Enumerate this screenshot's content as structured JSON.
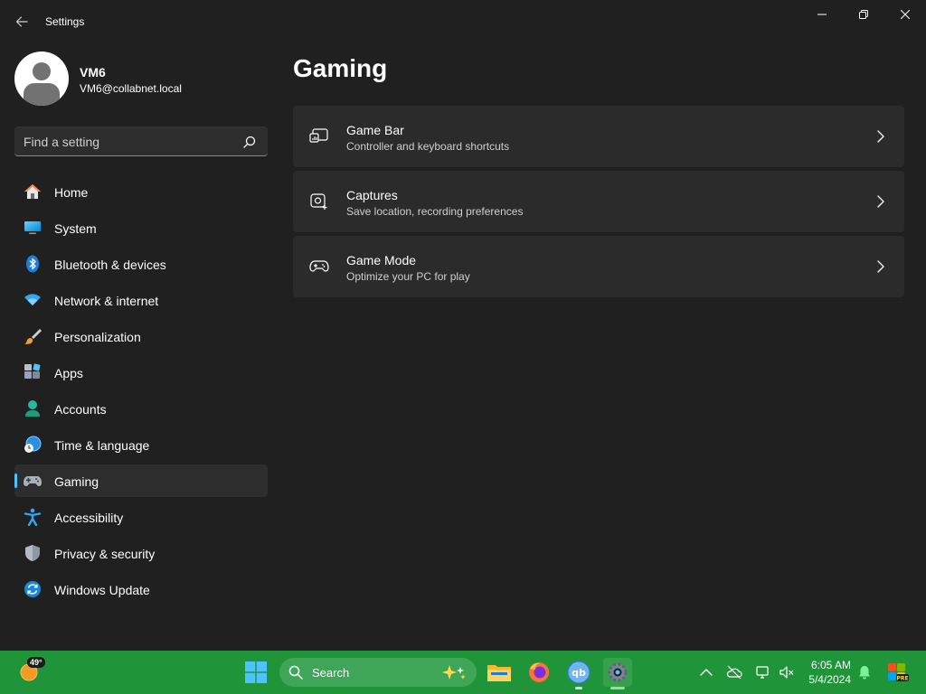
{
  "window": {
    "title": "Settings"
  },
  "profile": {
    "name": "VM6",
    "email": "VM6@collabnet.local"
  },
  "search": {
    "placeholder": "Find a setting"
  },
  "nav": {
    "items": [
      {
        "label": "Home",
        "icon": "home-icon"
      },
      {
        "label": "System",
        "icon": "system-icon"
      },
      {
        "label": "Bluetooth & devices",
        "icon": "bluetooth-icon"
      },
      {
        "label": "Network & internet",
        "icon": "wifi-icon"
      },
      {
        "label": "Personalization",
        "icon": "brush-icon"
      },
      {
        "label": "Apps",
        "icon": "apps-icon"
      },
      {
        "label": "Accounts",
        "icon": "account-icon"
      },
      {
        "label": "Time & language",
        "icon": "globe-clock-icon"
      },
      {
        "label": "Gaming",
        "icon": "gamepad-icon",
        "active": true
      },
      {
        "label": "Accessibility",
        "icon": "accessibility-icon"
      },
      {
        "label": "Privacy & security",
        "icon": "shield-icon"
      },
      {
        "label": "Windows Update",
        "icon": "update-icon"
      }
    ]
  },
  "main": {
    "title": "Gaming",
    "cards": [
      {
        "title": "Game Bar",
        "subtitle": "Controller and keyboard shortcuts",
        "icon": "game-bar-icon"
      },
      {
        "title": "Captures",
        "subtitle": "Save location, recording preferences",
        "icon": "capture-icon"
      },
      {
        "title": "Game Mode",
        "subtitle": "Optimize your PC for play",
        "icon": "controller-icon"
      }
    ]
  },
  "taskbar": {
    "weather": {
      "temp": "49°"
    },
    "search_label": "Search",
    "apps": [
      "file-explorer-icon",
      "firefox-icon",
      "qbittorrent-icon",
      "settings-app-icon"
    ],
    "clock": {
      "time": "6:05 AM",
      "date": "5/4/2024"
    }
  },
  "colors": {
    "background": "#202020",
    "card": "#2b2b2b",
    "accent": "#4cc2ff",
    "taskbar": "#1f9439"
  }
}
